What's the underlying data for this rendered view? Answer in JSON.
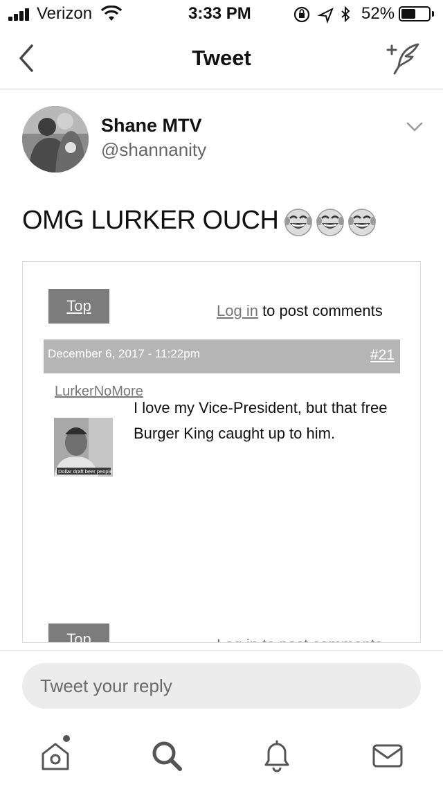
{
  "status_bar": {
    "carrier": "Verizon",
    "time": "3:33 PM",
    "battery_percent": "52%",
    "battery_level": 0.52
  },
  "nav": {
    "title": "Tweet",
    "back_icon": "chevron-left-icon",
    "compose_icon": "compose-tweet-icon"
  },
  "tweet": {
    "author_name": "Shane MTV",
    "author_handle": "@shannanity",
    "text": "OMG LURKER OUCH",
    "emoji": "face-with-tears-of-joy x3"
  },
  "embed": {
    "top_label": "Top",
    "login_link": "Log in",
    "login_suffix": " to post comments",
    "comment_date": "December 6, 2017 - 11:22pm",
    "comment_number": "#21",
    "comment_user": "LurkerNoMore",
    "comment_text": "I love my Vice-President, but that free Burger King caught up to him.",
    "thumb_caption": "Dollar draft beer people",
    "top_label_2": "Top",
    "login_line_2": "Log in to post comments"
  },
  "reply": {
    "placeholder": "Tweet your reply"
  },
  "tab_bar": {
    "items": [
      "home-icon",
      "search-icon",
      "notifications-bell-icon",
      "messages-envelope-icon"
    ]
  },
  "colors": {
    "text": "#111111",
    "secondary": "#666666",
    "divider": "#cfcfcf",
    "reply_bg": "#ececec"
  }
}
